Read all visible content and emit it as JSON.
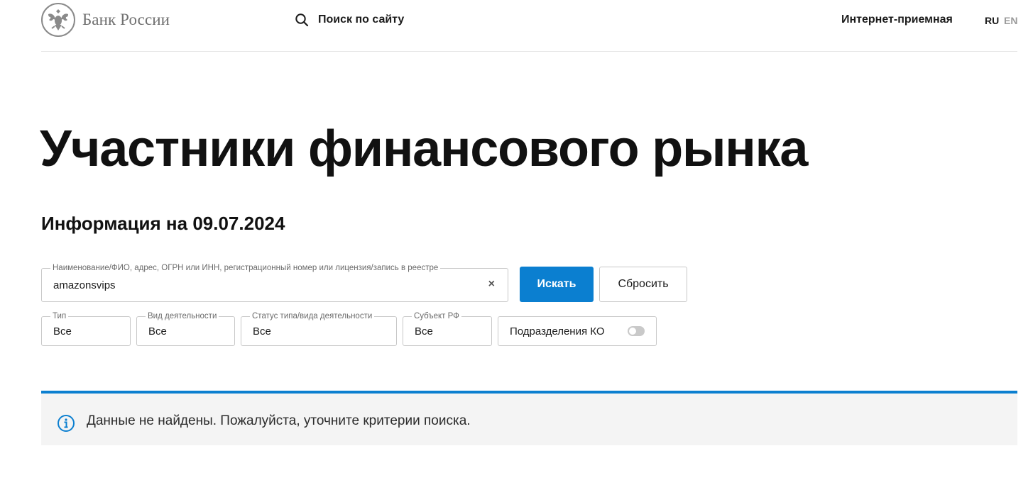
{
  "header": {
    "logo_text": "Банк России",
    "search_label": "Поиск по сайту",
    "reception_label": "Интернет-приемная",
    "lang_ru": "RU",
    "lang_en": "EN"
  },
  "main": {
    "title": "Участники финансового рынка",
    "subtitle": "Информация на 09.07.2024"
  },
  "search": {
    "legend": "Наименование/ФИО, адрес, ОГРН или ИНН, регистрационный номер или лицензия/запись в реестре",
    "value": "amazonsvips",
    "clear_icon": "×",
    "search_button": "Искать",
    "reset_button": "Сбросить"
  },
  "filters": {
    "type": {
      "label": "Тип",
      "value": "Все"
    },
    "activity": {
      "label": "Вид деятельности",
      "value": "Все"
    },
    "status": {
      "label": "Статус типа/вида деятельности",
      "value": "Все"
    },
    "region": {
      "label": "Субъект РФ",
      "value": "Все"
    },
    "branches": {
      "label": "Подразделения КО",
      "enabled": false
    }
  },
  "notice": {
    "text": "Данные не найдены. Пожалуйста, уточните критерии поиска.",
    "icon": "info-icon"
  },
  "colors": {
    "accent": "#0b7fd0",
    "notice_bg": "#f4f4f4",
    "logo_gray": "#707070"
  }
}
